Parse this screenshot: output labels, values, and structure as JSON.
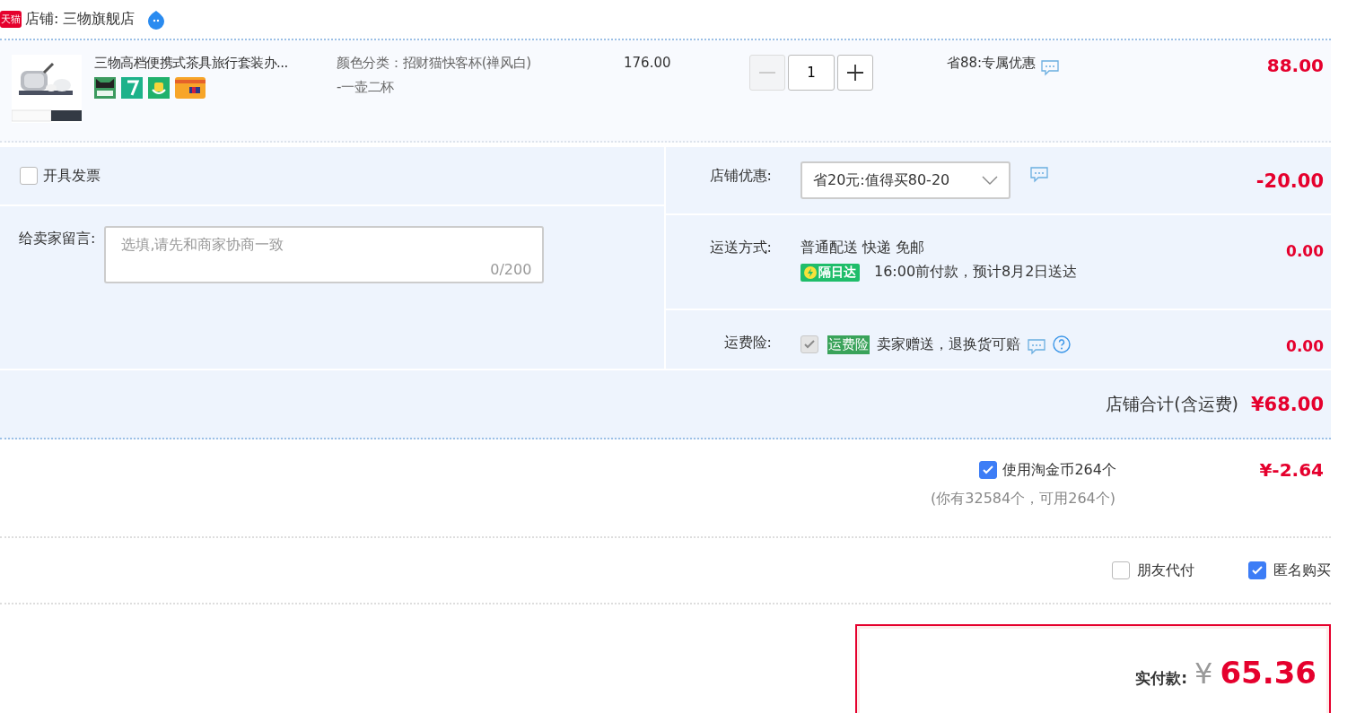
{
  "shop": {
    "badge": "天猫",
    "name": "店铺: 三物旗舰店"
  },
  "item": {
    "title": "三物高档便携式茶具旅行套装办...",
    "sku": [
      "颜色分类：招财猫快客杯(禅风白)",
      "-一壶二杯"
    ],
    "price": "176.00",
    "quantity": "1",
    "minus_disabled": true,
    "promo": "省88:专属优惠",
    "subtotal": "88.00"
  },
  "invoice": {
    "label": "开具发票",
    "checked": false
  },
  "message": {
    "label": "给卖家留言:",
    "placeholder": "选填,请先和商家协商一致",
    "counter": "0/200"
  },
  "discount": {
    "label": "店铺优惠:",
    "value": "省20元:值得买80-20",
    "amount": "-20.00"
  },
  "shipping": {
    "label": "运送方式:",
    "method": "普通配送 快递 免邮",
    "tag": "隔日达",
    "eta": "16:00前付款，预计8月2日送达",
    "amount": "0.00"
  },
  "insurance": {
    "label": "运费险:",
    "checked": true,
    "disabled": true,
    "tag": "运费险",
    "text": "卖家赠送，退换货可赔",
    "amount": "0.00"
  },
  "shop_total": {
    "label": "店铺合计(含运费)",
    "amount": "¥68.00"
  },
  "coins": {
    "label": "使用淘金币264个",
    "checked": true,
    "amount": "¥-2.64",
    "note": "(你有32584个，可用264个)"
  },
  "options": [
    {
      "label": "朋友代付",
      "checked": false
    },
    {
      "label": "匿名购买",
      "checked": true
    }
  ],
  "pay": {
    "label": "实付款:",
    "currency": "¥",
    "amount": "65.36"
  }
}
